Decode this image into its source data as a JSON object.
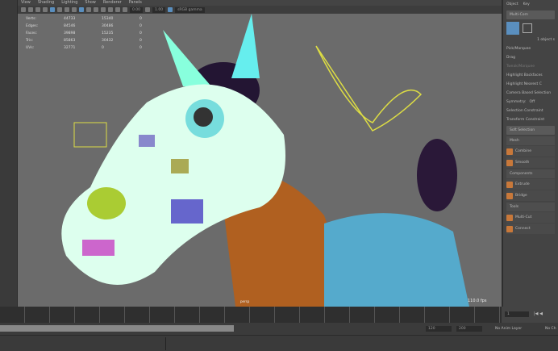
{
  "menu": [
    "View",
    "Shading",
    "Lighting",
    "Show",
    "Renderer",
    "Panels"
  ],
  "toolbar": {
    "exposure": "0.00",
    "gamma": "1.00",
    "color_space": "sRGB gamma"
  },
  "hud": [
    [
      "Verts:",
      "44733",
      "15340",
      "0"
    ],
    [
      "Edges:",
      "84546",
      "30486",
      "0"
    ],
    [
      "Faces:",
      "39898",
      "15235",
      "0"
    ],
    [
      "Tris:",
      "85863",
      "30432",
      "0"
    ],
    [
      "UVs:",
      "32771",
      "0",
      "0"
    ]
  ],
  "viewport": {
    "fps": "110.0 fps",
    "camera": "persp"
  },
  "right": {
    "tabs": [
      "Object",
      "Key"
    ],
    "multi_component": "Multi-Com",
    "object_count": "1 object s",
    "pick": "Pick/Marquee",
    "drag": "Drag",
    "tweak": "Tweak/Marquee",
    "highlight_backfaces": "Highlight Backfaces",
    "highlight_nearest": "Highlight Nearest C",
    "camera_based": "Camera Based Selection",
    "symmetry": "Symmetry:",
    "symmetry_value": "Off",
    "selection_constraint": "Selection Constraint",
    "transform_constraint": "Transform Constraint",
    "soft_selection": "Soft Selection",
    "sections": [
      {
        "title": "Mesh",
        "tools": [
          "Combine",
          "Smooth"
        ]
      },
      {
        "title": "Components",
        "tools": [
          "Extrude",
          "Bridge"
        ]
      },
      {
        "title": "Tools",
        "tools": [
          "Multi-Cut",
          "Connect"
        ]
      }
    ]
  },
  "timeline": {
    "current_frame": "1"
  },
  "range": {
    "end": "120",
    "max": "200",
    "anim_layer": "No Anim Layer",
    "character": "No Ch"
  },
  "colors": {
    "selected": "#5a8fbf",
    "viewport": "#6b6b6b",
    "accent": "#c8783a"
  }
}
